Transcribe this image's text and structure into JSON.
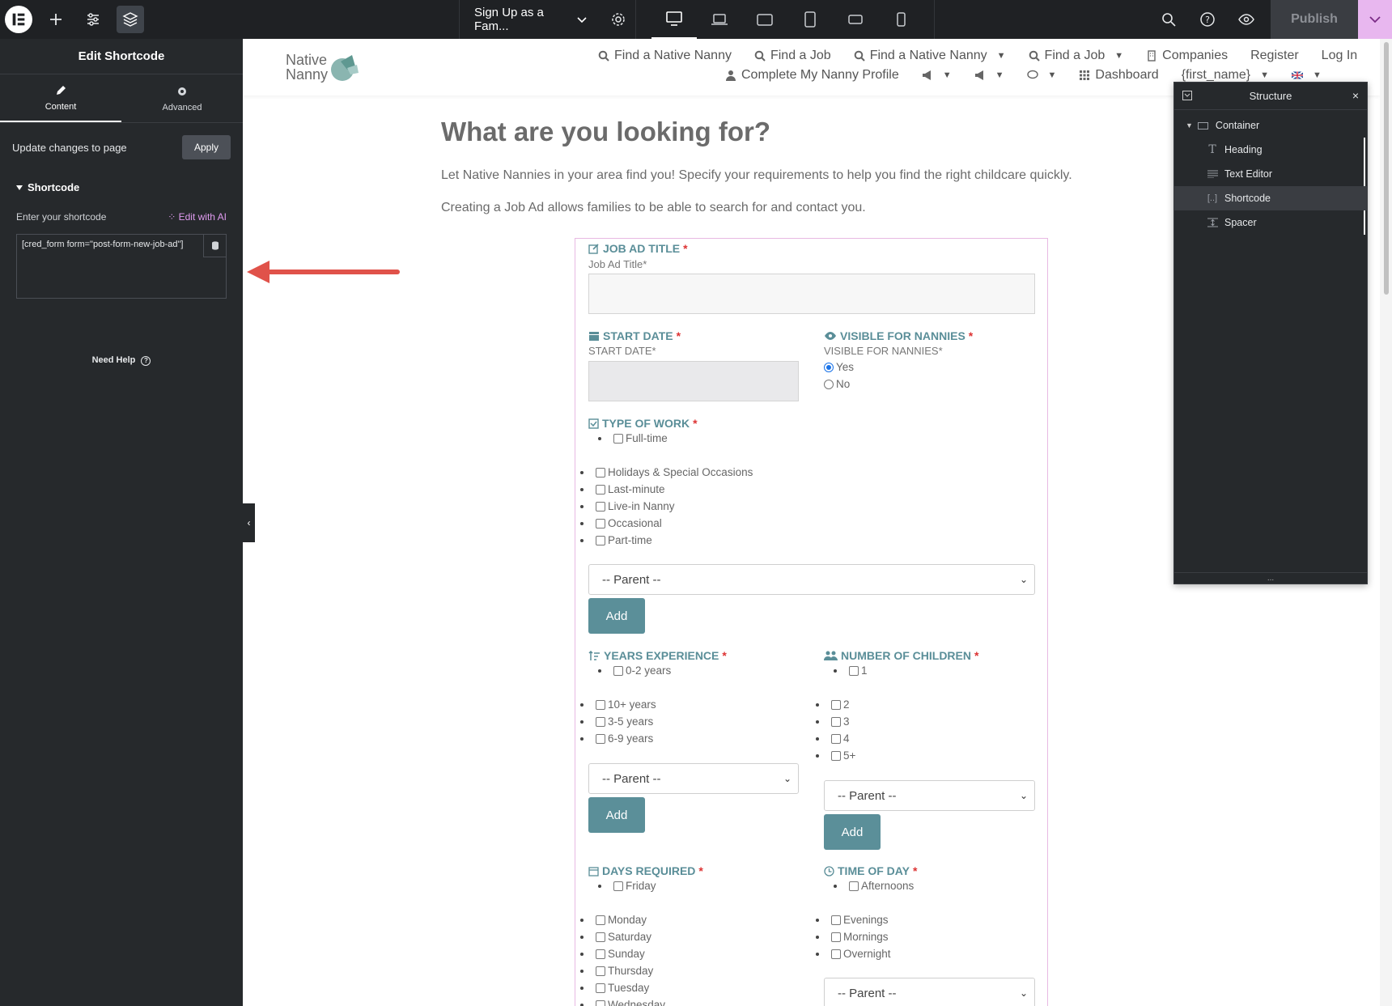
{
  "topbar": {
    "page_name": "Sign Up as a Fam...",
    "publish_label": "Publish"
  },
  "left_panel": {
    "title": "Edit Shortcode",
    "tabs": [
      {
        "label": "Content"
      },
      {
        "label": "Advanced"
      }
    ],
    "update_text": "Update changes to page",
    "apply_label": "Apply",
    "section_title": "Shortcode",
    "shortcode_label": "Enter your shortcode",
    "edit_ai_label": "Edit with AI",
    "shortcode_value": "[cred_form form=\"post-form-new-job-ad\"]",
    "need_help": "Need Help"
  },
  "site": {
    "logo": {
      "line1": "Native",
      "line2": "Nanny"
    },
    "nav_row1": [
      "Find a Native Nanny",
      "Find a Job",
      "Find a Native Nanny",
      "Find a Job",
      "Companies",
      "Register",
      "Log In"
    ],
    "nav_row2": [
      "Complete My Nanny Profile",
      "Dashboard",
      "{first_name}"
    ]
  },
  "content": {
    "heading": "What are you looking for?",
    "text1": "Let Native Nannies in your area find you! Specify your requirements to help you find the right childcare quickly.",
    "text2": "Creating a Job Ad allows families to be able to search for and contact you."
  },
  "form": {
    "job_title": {
      "label": "JOB AD TITLE",
      "sub": "Job Ad Title*"
    },
    "start_date": {
      "label": "START DATE",
      "sub": "START DATE*"
    },
    "visible": {
      "label": "VISIBLE FOR NANNIES",
      "sub": "VISIBLE FOR NANNIES*",
      "options": [
        "Yes",
        "No"
      ],
      "selected": "Yes"
    },
    "type_of_work": {
      "label": "TYPE OF WORK",
      "first": "Full-time",
      "options": [
        "Holidays & Special Occasions",
        "Last-minute",
        "Live-in Nanny",
        "Occasional",
        "Part-time"
      ]
    },
    "parent_placeholder": "-- Parent --",
    "add_label": "Add",
    "years_exp": {
      "label": "YEARS EXPERIENCE",
      "first": "0-2 years",
      "options": [
        "10+ years",
        "3-5 years",
        "6-9 years"
      ]
    },
    "num_children": {
      "label": "NUMBER OF CHILDREN",
      "first": "1",
      "options": [
        "2",
        "3",
        "4",
        "5+"
      ]
    },
    "days_required": {
      "label": "DAYS REQUIRED",
      "first": "Friday",
      "options": [
        "Monday",
        "Saturday",
        "Sunday",
        "Thursday",
        "Tuesday",
        "Wednesday"
      ]
    },
    "time_of_day": {
      "label": "TIME OF DAY",
      "first": "Afternoons",
      "options": [
        "Evenings",
        "Mornings",
        "Overnight"
      ]
    },
    "required_mark": "*"
  },
  "structure": {
    "title": "Structure",
    "items": [
      "Container",
      "Heading",
      "Text Editor",
      "Shortcode",
      "Spacer"
    ],
    "selected": "Shortcode",
    "footer": "..."
  },
  "colors": {
    "accent": "#5b8f99",
    "topbar": "#1f2124",
    "panel": "#26292c",
    "ai": "#e09bf0",
    "arrow": "#e0524a"
  }
}
